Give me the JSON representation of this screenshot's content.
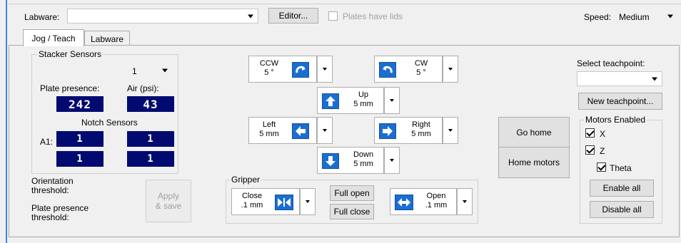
{
  "toolbar": {
    "labware_label": "Labware:",
    "labware_value": "",
    "editor_label": "Editor...",
    "plates_have_lids_label": "Plates have lids",
    "speed_label": "Speed:",
    "speed_value": "Medium"
  },
  "tabs": [
    {
      "label": "Jog / Teach",
      "active": true
    },
    {
      "label": "Labware",
      "active": false
    }
  ],
  "stacker": {
    "legend": "Stacker Sensors",
    "stacker_select": "1",
    "plate_presence_label": "Plate presence:",
    "air_label": "Air (psi):",
    "plate_presence_value": "242",
    "air_value": "43",
    "notch_label": "Notch Sensors",
    "a1_label": "A1:",
    "notch_values": [
      "1",
      "1",
      "1",
      "1"
    ],
    "orientation_label": "Orientation threshold:",
    "plate_presence_threshold_label": "Plate presence threshold:",
    "apply_label": "Apply & save"
  },
  "jog": {
    "ccw": {
      "label": "CCW",
      "step": "5 °"
    },
    "cw": {
      "label": "CW",
      "step": "5 °"
    },
    "up": {
      "label": "Up",
      "step": "5 mm"
    },
    "left": {
      "label": "Left",
      "step": "5 mm"
    },
    "right": {
      "label": "Right",
      "step": "5 mm"
    },
    "down": {
      "label": "Down",
      "step": "5 mm"
    }
  },
  "gripper": {
    "legend": "Gripper",
    "close": {
      "label": "Close",
      "step": ".1 mm"
    },
    "full_open_label": "Full open",
    "full_close_label": "Full close",
    "open": {
      "label": "Open",
      "step": ".1 mm"
    }
  },
  "home": {
    "go_home_label": "Go home",
    "home_motors_label": "Home motors"
  },
  "teach": {
    "select_label": "Select teachpoint:",
    "select_value": "",
    "new_teachpoint_label": "New teachpoint..."
  },
  "motors": {
    "legend": "Motors Enabled",
    "items": [
      {
        "label": "X",
        "checked": true
      },
      {
        "label": "Z",
        "checked": true
      },
      {
        "label": "Theta",
        "checked": true
      }
    ],
    "enable_all_label": "Enable all",
    "disable_all_label": "Disable all"
  },
  "colors": {
    "accent": "#1a6ed1",
    "display_bg": "#000a70",
    "display_fg": "#ffffff",
    "left_accent": "#3c82ff"
  }
}
